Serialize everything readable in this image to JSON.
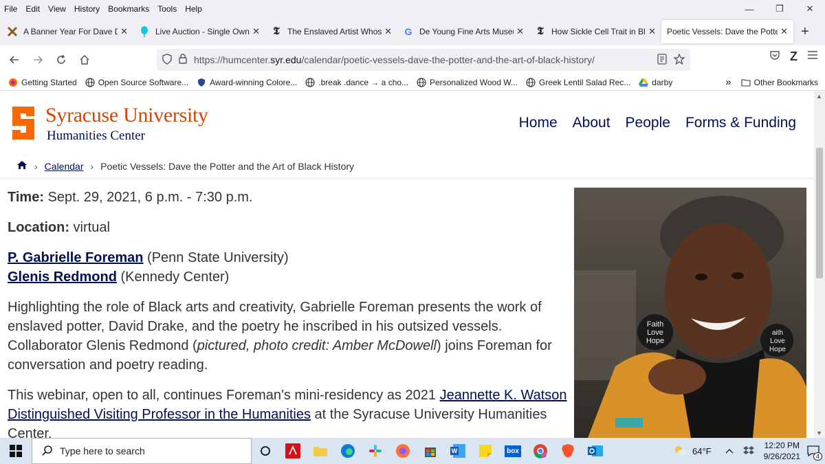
{
  "menubar": {
    "items": [
      "File",
      "Edit",
      "View",
      "History",
      "Bookmarks",
      "Tools",
      "Help"
    ]
  },
  "window_controls": {
    "minimize": "—",
    "restore": "❐",
    "close": "✕"
  },
  "tabs": [
    {
      "label": "A Banner Year For Dave Drake",
      "icon": "ax-icon"
    },
    {
      "label": "Live Auction - Single Owner",
      "icon": "balloon-icon"
    },
    {
      "label": "The Enslaved Artist Whose P",
      "icon": "nyt-icon"
    },
    {
      "label": "De Young Fine Arts Museum",
      "icon": "google-icon"
    },
    {
      "label": "How Sickle Cell Trait in Black",
      "icon": "nyt-icon"
    },
    {
      "label": "Poetic Vessels: Dave the Potter a",
      "icon": "none",
      "active": true
    }
  ],
  "tab_close_glyph": "✕",
  "new_tab_glyph": "+",
  "urlbar": {
    "prefix": "https://humcenter.",
    "domain": "syr.edu",
    "path": "/calendar/poetic-vessels-dave-the-potter-and-the-art-of-black-history/"
  },
  "bookmarks": [
    {
      "label": "Getting Started",
      "icon": "firefox-icon"
    },
    {
      "label": "Open Source Software...",
      "icon": "globe-icon"
    },
    {
      "label": "Award-winning Colore...",
      "icon": "shield-icon"
    },
    {
      "label": ".break .dance → a cho...",
      "icon": "globe-icon"
    },
    {
      "label": "Personalized Wood W...",
      "icon": "globe-icon"
    },
    {
      "label": "Greek Lentil Salad Rec...",
      "icon": "globe-icon"
    },
    {
      "label": "darby",
      "icon": "drive-icon"
    }
  ],
  "bookmarks_more": "»",
  "other_bookmarks": "Other Bookmarks",
  "site": {
    "title": "Syracuse University",
    "subtitle": "Humanities Center",
    "nav": [
      "Home",
      "About",
      "People",
      "Forms & Funding"
    ],
    "brand_color": "#d44500",
    "navy": "#000e54"
  },
  "breadcrumb": {
    "link": "Calendar",
    "current": "Poetic Vessels: Dave the Potter and the Art of Black History",
    "sep": "›"
  },
  "event": {
    "time_label": "Time:",
    "time_value": " Sept. 29, 2021, 6 p.m. - 7:30 p.m.",
    "location_label": "Location:",
    "location_value": " virtual",
    "speaker1_name": "P. Gabrielle Foreman",
    "speaker1_aff": " (Penn State University)",
    "speaker2_name": "Glenis Redmond",
    "speaker2_aff": " (Kennedy Center)",
    "para1_a": "Highlighting the role of Black arts and creativity, Gabrielle Foreman presents the work of enslaved potter, David Drake, and the poetry he inscribed in his outsized vessels. Collaborator Glenis Redmond (",
    "para1_em": "pictured, photo credit: Amber McDowell",
    "para1_b": ") joins Foreman for conversation and poetry reading.",
    "para2_a": "This webinar, open to all, continues Foreman's mini-residency as 2021 ",
    "para2_link": "Jeannette K. Watson Distinguished Visiting Professor in the Humanities",
    "para2_b": " at the Syracuse University Humanities Center."
  },
  "photo": {
    "earring_left": [
      "Faith",
      "Love",
      "Hope"
    ],
    "earring_right": [
      "aith",
      "Love",
      "Hope"
    ]
  },
  "taskbar": {
    "search_placeholder": "Type here to search",
    "weather": "64°F",
    "time": "12:20 PM",
    "date": "9/26/2021",
    "notifications": "4",
    "box_label": "box"
  }
}
